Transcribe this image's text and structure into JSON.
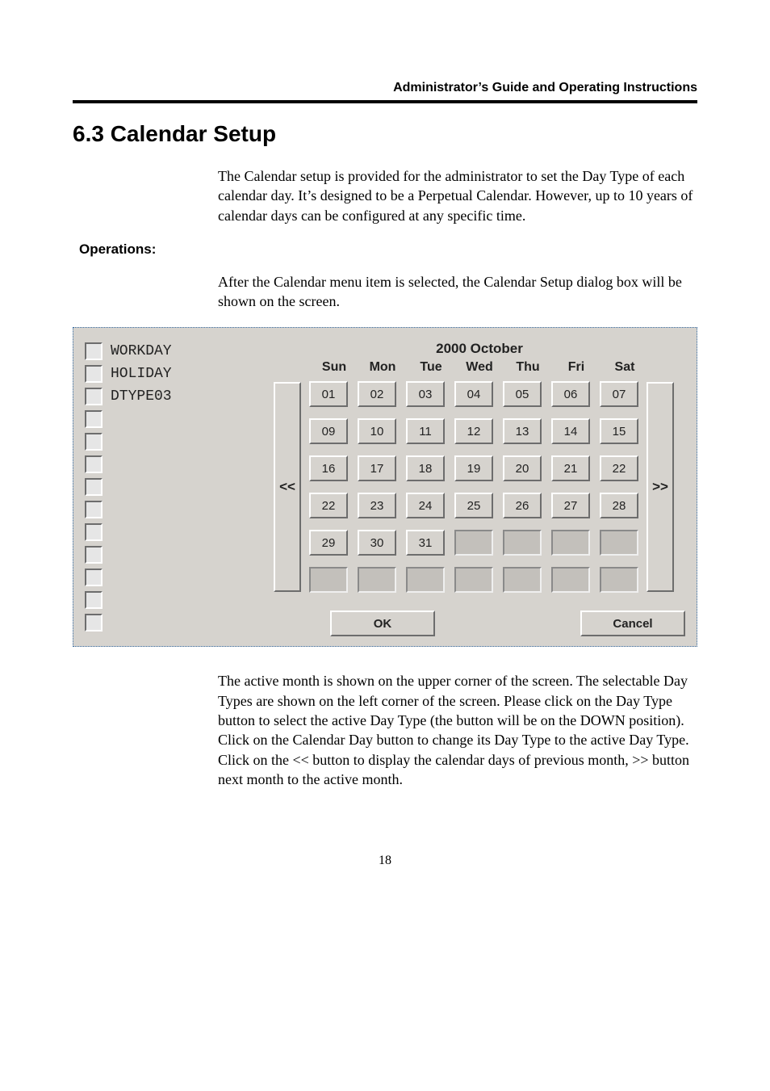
{
  "header": {
    "running": "Administrator’s Guide and Operating Instructions"
  },
  "section": {
    "title": "6.3 Calendar Setup",
    "para1": "The Calendar setup is provided for the administrator to set the Day Type of each calendar day.   It’s designed to be a Perpetual Calendar.  However, up to 10 years of calendar days can be configured at any specific time.",
    "operations_heading": "Operations:",
    "para2": "After the Calendar menu item is selected, the Calendar Setup dialog box will be shown on the screen.",
    "para3": "The active month is shown on the upper corner of the screen.    The selectable Day Types are shown on the left corner of the screen.  Please click on the Day Type button to select the active Day Type (the button will be on the DOWN position).   Click on the Calendar Day button to change its Day Type to the active Day Type.    Click on the << button to display the calendar days of previous month, >> button next month to the active month.",
    "page_number": "18"
  },
  "dialog": {
    "daytypes": {
      "0": "WORKDAY",
      "1": "HOLIDAY",
      "2": "DTYPE03"
    },
    "month_title": "2000   October",
    "nav_prev": "<<",
    "nav_next": ">>",
    "week": {
      "sun": "Sun",
      "mon": "Mon",
      "tue": "Tue",
      "wed": "Wed",
      "thu": "Thu",
      "fri": "Fri",
      "sat": "Sat"
    },
    "days": {
      "r0c0": "01",
      "r0c1": "02",
      "r0c2": "03",
      "r0c3": "04",
      "r0c4": "05",
      "r0c5": "06",
      "r0c6": "07",
      "r1c0": "09",
      "r1c1": "10",
      "r1c2": "11",
      "r1c3": "12",
      "r1c4": "13",
      "r1c5": "14",
      "r1c6": "15",
      "r2c0": "16",
      "r2c1": "17",
      "r2c2": "18",
      "r2c3": "19",
      "r2c4": "20",
      "r2c5": "21",
      "r2c6": "22",
      "r3c0": "22",
      "r3c1": "23",
      "r3c2": "24",
      "r3c3": "25",
      "r3c4": "26",
      "r3c5": "27",
      "r3c6": "28",
      "r4c0": "29",
      "r4c1": "30",
      "r4c2": "31"
    },
    "buttons": {
      "ok": "OK",
      "cancel": "Cancel"
    }
  }
}
